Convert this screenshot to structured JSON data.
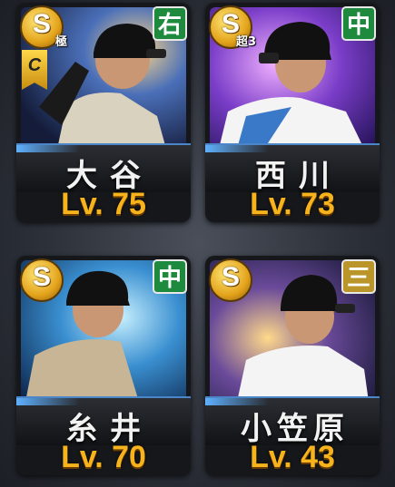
{
  "cards": [
    {
      "name": "大谷",
      "level": "Lv. 75",
      "position": "右",
      "rank": "S",
      "rank_sub": "極",
      "has_c_badge": true,
      "c_badge": "C",
      "position_color": "#1e8a3e"
    },
    {
      "name": "西川",
      "level": "Lv. 73",
      "position": "中",
      "rank": "S",
      "rank_sub": "超3",
      "has_c_badge": false,
      "position_color": "#1e8a3e"
    },
    {
      "name": "糸井",
      "level": "Lv. 70",
      "position": "中",
      "rank": "S",
      "rank_sub": "",
      "has_c_badge": false,
      "position_color": "#1e8a3e"
    },
    {
      "name": "小笠原",
      "level": "Lv. 43",
      "position": "三",
      "rank": "S",
      "rank_sub": "",
      "has_c_badge": false,
      "position_color": "#b9952a"
    }
  ]
}
